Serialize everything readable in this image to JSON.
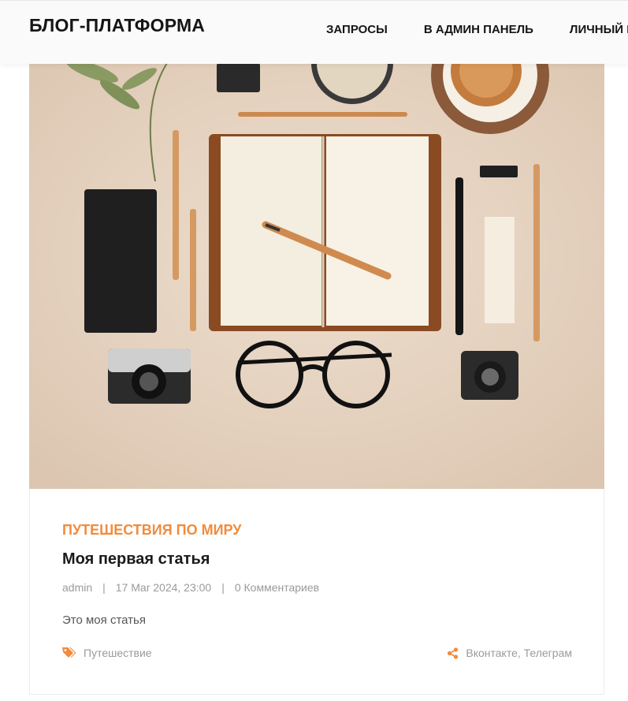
{
  "header": {
    "logo": "БЛОГ-ПЛАТФОРМА",
    "nav": [
      {
        "label": "ЗАПРОСЫ"
      },
      {
        "label": "В АДМИН ПАНЕЛЬ"
      },
      {
        "label": "ЛИЧНЫЙ КАБИНЕТ"
      }
    ]
  },
  "post": {
    "image_icon": "flat-lay-desk-photo",
    "category": "ПУТЕШЕСТВИЯ ПО МИРУ",
    "title": "Моя первая статья",
    "author": "admin",
    "date": "17 Mar 2024, 23:00",
    "comments": "0 Комментариев",
    "excerpt": "Это моя статья",
    "tag": "Путешествие",
    "share_links": "Вконтакте, Телеграм"
  },
  "colors": {
    "accent": "#f28b3b",
    "text_dark": "#1a1a1a",
    "text_muted": "#9a9a9a",
    "hero_bg": "#e9d8c6"
  }
}
